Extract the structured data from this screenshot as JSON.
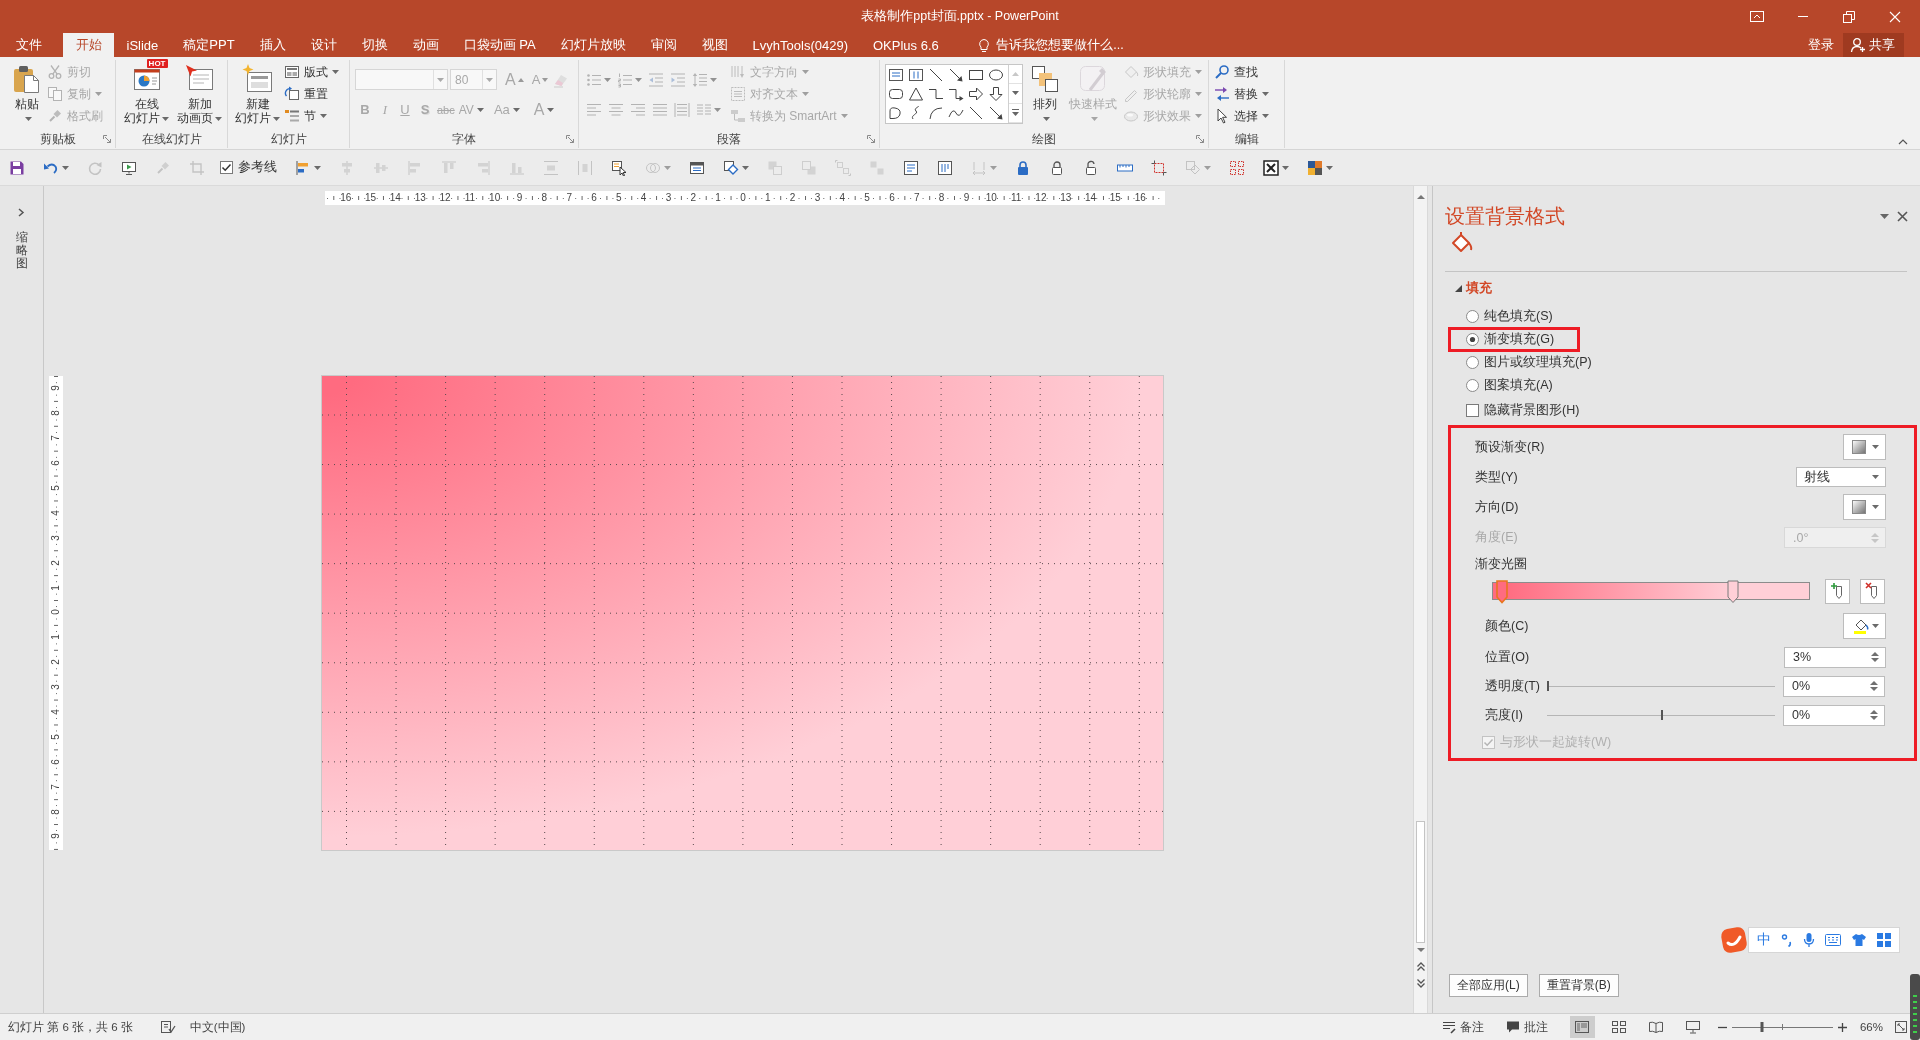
{
  "window": {
    "title": "表格制作ppt封面.pptx - PowerPoint"
  },
  "tabs": [
    {
      "label": "文件",
      "selected": false
    },
    {
      "label": "开始",
      "selected": true
    },
    {
      "label": "iSlide",
      "selected": false
    },
    {
      "label": "稿定PPT",
      "selected": false
    },
    {
      "label": "插入",
      "selected": false
    },
    {
      "label": "设计",
      "selected": false
    },
    {
      "label": "切换",
      "selected": false
    },
    {
      "label": "动画",
      "selected": false
    },
    {
      "label": "口袋动画 PA",
      "selected": false
    },
    {
      "label": "幻灯片放映",
      "selected": false
    },
    {
      "label": "审阅",
      "selected": false
    },
    {
      "label": "视图",
      "selected": false
    },
    {
      "label": "LvyhTools(0429)",
      "selected": false
    },
    {
      "label": "OKPlus 6.6",
      "selected": false
    }
  ],
  "tell_me": {
    "placeholder": "告诉我您想要做什么..."
  },
  "account": {
    "sign_in": "登录",
    "share": "共享"
  },
  "ribbon": [
    {
      "label": "剪贴板",
      "launcher": true,
      "columns": [
        {
          "kind": "large",
          "label": [
            "粘贴"
          ],
          "caret": true,
          "disabled": false
        },
        {
          "kind": "stack",
          "items": [
            {
              "label": "剪切",
              "disabled": true
            },
            {
              "label": "复制",
              "caret": true,
              "disabled": true
            },
            {
              "label": "格式刷",
              "disabled": true
            }
          ]
        }
      ]
    },
    {
      "label": "在线幻灯片",
      "launcher": false,
      "columns": [
        {
          "kind": "large",
          "label": [
            "在线",
            "幻灯片"
          ],
          "caret": true,
          "badge": "HOT",
          "disabled": false
        },
        {
          "kind": "large",
          "label": [
            "新加",
            "动画页"
          ],
          "caret": true,
          "disabled": false
        }
      ]
    },
    {
      "label": "幻灯片",
      "launcher": false,
      "columns": [
        {
          "kind": "large",
          "label": [
            "新建",
            "幻灯片"
          ],
          "caret": true,
          "disabled": false
        },
        {
          "kind": "stack",
          "items": [
            {
              "label": "版式",
              "caret": true,
              "disabled": false
            },
            {
              "label": "重置",
              "disabled": false
            },
            {
              "label": "节",
              "caret": true,
              "disabled": false
            }
          ]
        }
      ]
    },
    {
      "label": "字体",
      "launcher": true,
      "columns": [
        {
          "kind": "rows",
          "rows": [
            {
              "items": [
                {
                  "kind": "combo",
                  "disabled": true
                },
                {
                  "kind": "combo",
                  "value": "80",
                  "disabled": true
                },
                {
                  "kind": "glyph",
                  "label": "A",
                  "disabled": true
                },
                {
                  "kind": "glyph",
                  "label": "A",
                  "disabled": true
                },
                {
                  "kind": "icon",
                  "disabled": true
                }
              ]
            },
            {
              "items": [
                {
                  "kind": "glyph",
                  "label": "B",
                  "disabled": true
                },
                {
                  "kind": "glyph",
                  "label": "I",
                  "disabled": true
                },
                {
                  "kind": "glyph",
                  "label": "U",
                  "disabled": true
                },
                {
                  "kind": "glyph",
                  "label": "S",
                  "disabled": true
                },
                {
                  "kind": "glyph",
                  "label": "abc",
                  "disabled": true
                },
                {
                  "kind": "glyph",
                  "label": "AV",
                  "caret": true,
                  "disabled": true
                },
                {
                  "kind": "glyph",
                  "label": "Aa",
                  "caret": true,
                  "disabled": true
                },
                {
                  "kind": "glyph",
                  "label": "A",
                  "caret": true,
                  "disabled": true
                }
              ]
            }
          ]
        }
      ]
    },
    {
      "label": "段落",
      "launcher": true,
      "columns": [
        {
          "kind": "rows",
          "rows": [
            {
              "items": [
                {
                  "kind": "icon",
                  "caret": true,
                  "disabled": true
                },
                {
                  "kind": "icon",
                  "caret": true,
                  "disabled": true
                },
                {
                  "kind": "icon",
                  "disabled": true
                },
                {
                  "kind": "icon",
                  "disabled": true
                },
                {
                  "kind": "icon",
                  "caret": true,
                  "disabled": true
                }
              ]
            },
            {
              "items": [
                {
                  "kind": "icon",
                  "disabled": true
                },
                {
                  "kind": "icon",
                  "disabled": true
                },
                {
                  "kind": "icon",
                  "disabled": true
                },
                {
                  "kind": "icon",
                  "disabled": true
                },
                {
                  "kind": "icon",
                  "disabled": true
                },
                {
                  "kind": "icon",
                  "caret": true,
                  "disabled": true
                }
              ]
            }
          ]
        },
        {
          "kind": "stack",
          "items": [
            {
              "label": "文字方向",
              "caret": true,
              "disabled": true
            },
            {
              "label": "对齐文本",
              "caret": true,
              "disabled": true
            },
            {
              "label": "转换为 SmartArt",
              "caret": true,
              "disabled": true
            }
          ]
        }
      ]
    },
    {
      "label": "绘图",
      "launcher": true,
      "columns": [
        {
          "kind": "gallery"
        },
        {
          "kind": "large",
          "label": [
            "排列"
          ],
          "caret": true,
          "disabled": false
        },
        {
          "kind": "large",
          "label": [
            "快速样式"
          ],
          "caret": true,
          "disabled": true
        },
        {
          "kind": "stack",
          "items": [
            {
              "label": "形状填充",
              "caret": true,
              "disabled": true
            },
            {
              "label": "形状轮廓",
              "caret": true,
              "disabled": true
            },
            {
              "label": "形状效果",
              "caret": true,
              "disabled": true
            }
          ]
        }
      ]
    },
    {
      "label": "编辑",
      "launcher": false,
      "columns": [
        {
          "kind": "stack",
          "items": [
            {
              "label": "查找",
              "disabled": false
            },
            {
              "label": "替换",
              "caret": true,
              "disabled": false
            },
            {
              "label": "选择",
              "caret": true,
              "disabled": false
            }
          ]
        }
      ]
    }
  ],
  "quick_access": [
    {
      "kind": "button",
      "disabled": false
    },
    {
      "kind": "split",
      "disabled": false
    },
    {
      "kind": "button",
      "disabled": true
    },
    {
      "kind": "button",
      "disabled": false
    },
    {
      "kind": "button",
      "disabled": true
    },
    {
      "kind": "button",
      "disabled": true
    },
    {
      "kind": "checkbox",
      "label": "参考线",
      "checked": true
    },
    {
      "kind": "split",
      "disabled": false
    },
    {
      "kind": "button",
      "disabled": true
    },
    {
      "kind": "button",
      "disabled": true
    },
    {
      "kind": "button",
      "disabled": true
    },
    {
      "kind": "button",
      "disabled": true
    },
    {
      "kind": "button",
      "disabled": true
    },
    {
      "kind": "button",
      "disabled": true
    },
    {
      "kind": "button",
      "disabled": true
    },
    {
      "kind": "button",
      "disabled": true
    },
    {
      "kind": "button",
      "disabled": false
    },
    {
      "kind": "split",
      "disabled": true
    },
    {
      "kind": "button",
      "disabled": false
    },
    {
      "kind": "split",
      "disabled": false
    },
    {
      "kind": "button",
      "disabled": true
    },
    {
      "kind": "button",
      "disabled": true
    },
    {
      "kind": "button",
      "disabled": true
    },
    {
      "kind": "button",
      "disabled": true
    },
    {
      "kind": "button",
      "disabled": false
    },
    {
      "kind": "button",
      "disabled": false
    },
    {
      "kind": "split",
      "disabled": true
    },
    {
      "kind": "button",
      "disabled": false
    },
    {
      "kind": "button",
      "disabled": false
    },
    {
      "kind": "button",
      "disabled": false
    },
    {
      "kind": "button",
      "disabled": false
    },
    {
      "kind": "button",
      "disabled": false
    },
    {
      "kind": "split",
      "disabled": true
    },
    {
      "kind": "button",
      "disabled": false
    },
    {
      "kind": "split",
      "disabled": false
    },
    {
      "kind": "split",
      "disabled": false
    }
  ],
  "thumbnail_pane": {
    "label": "缩略图"
  },
  "rulers": {
    "horizontal": [
      "16",
      "15",
      "14",
      "13",
      "12",
      "11",
      "10",
      "9",
      "8",
      "7",
      "6",
      "5",
      "4",
      "3",
      "2",
      "1",
      "0",
      "1",
      "2",
      "3",
      "4",
      "5",
      "6",
      "7",
      "8",
      "9",
      "10",
      "11",
      "12",
      "13",
      "14",
      "15",
      "16"
    ],
    "vertical": [
      "9",
      "8",
      "7",
      "6",
      "5",
      "4",
      "3",
      "2",
      "1",
      "0",
      "1",
      "2",
      "3",
      "4",
      "5",
      "6",
      "7",
      "8",
      "9"
    ]
  },
  "format_pane": {
    "title": "设置背景格式",
    "section": {
      "label": "填充",
      "expanded": true
    },
    "fill_options": [
      {
        "label": "纯色填充(S)",
        "selected": false,
        "highlighted": false
      },
      {
        "label": "渐变填充(G)",
        "selected": true,
        "highlighted": true
      },
      {
        "label": "图片或纹理填充(P)",
        "selected": false,
        "highlighted": false
      },
      {
        "label": "图案填充(A)",
        "selected": false,
        "highlighted": false
      }
    ],
    "hide_background_graphics": {
      "label": "隐藏背景图形(H)",
      "checked": false
    },
    "gradient": {
      "highlighted": true,
      "preset": {
        "label": "预设渐变(R)"
      },
      "type": {
        "label": "类型(Y)",
        "value": "射线"
      },
      "direction": {
        "label": "方向(D)"
      },
      "angle": {
        "label": "角度(E)",
        "value": ".0°",
        "disabled": true
      },
      "stops": {
        "label": "渐变光圈",
        "items": [
          {
            "level": 0.03,
            "color": "#ff6b80",
            "selected": true
          },
          {
            "level": 0.76,
            "color": "#ffcfd7",
            "selected": false
          }
        ]
      },
      "color": {
        "label": "颜色(C)"
      },
      "position": {
        "label": "位置(O)",
        "value": "3%"
      },
      "transparency": {
        "label": "透明度(T)",
        "level": 0,
        "value": "0%"
      },
      "brightness": {
        "label": "亮度(I)",
        "level": 0.5,
        "value": "0%"
      },
      "rotate_with_shape": {
        "label": "与形状一起旋转(W)",
        "checked": true,
        "disabled": true
      }
    },
    "buttons": [
      "全部应用(L)",
      "重置背景(B)"
    ]
  },
  "status_bar": {
    "slide_info": "幻灯片 第 6 张，共 6 张",
    "language": "中文(中国)",
    "notes": "备注",
    "comments": "批注",
    "views": [
      {
        "selected": true
      },
      {
        "selected": false
      },
      {
        "selected": false
      },
      {
        "selected": false
      }
    ],
    "zoom": {
      "level": 0.3,
      "value": "66%"
    }
  },
  "ime_toolbar": {
    "mode": "中"
  }
}
